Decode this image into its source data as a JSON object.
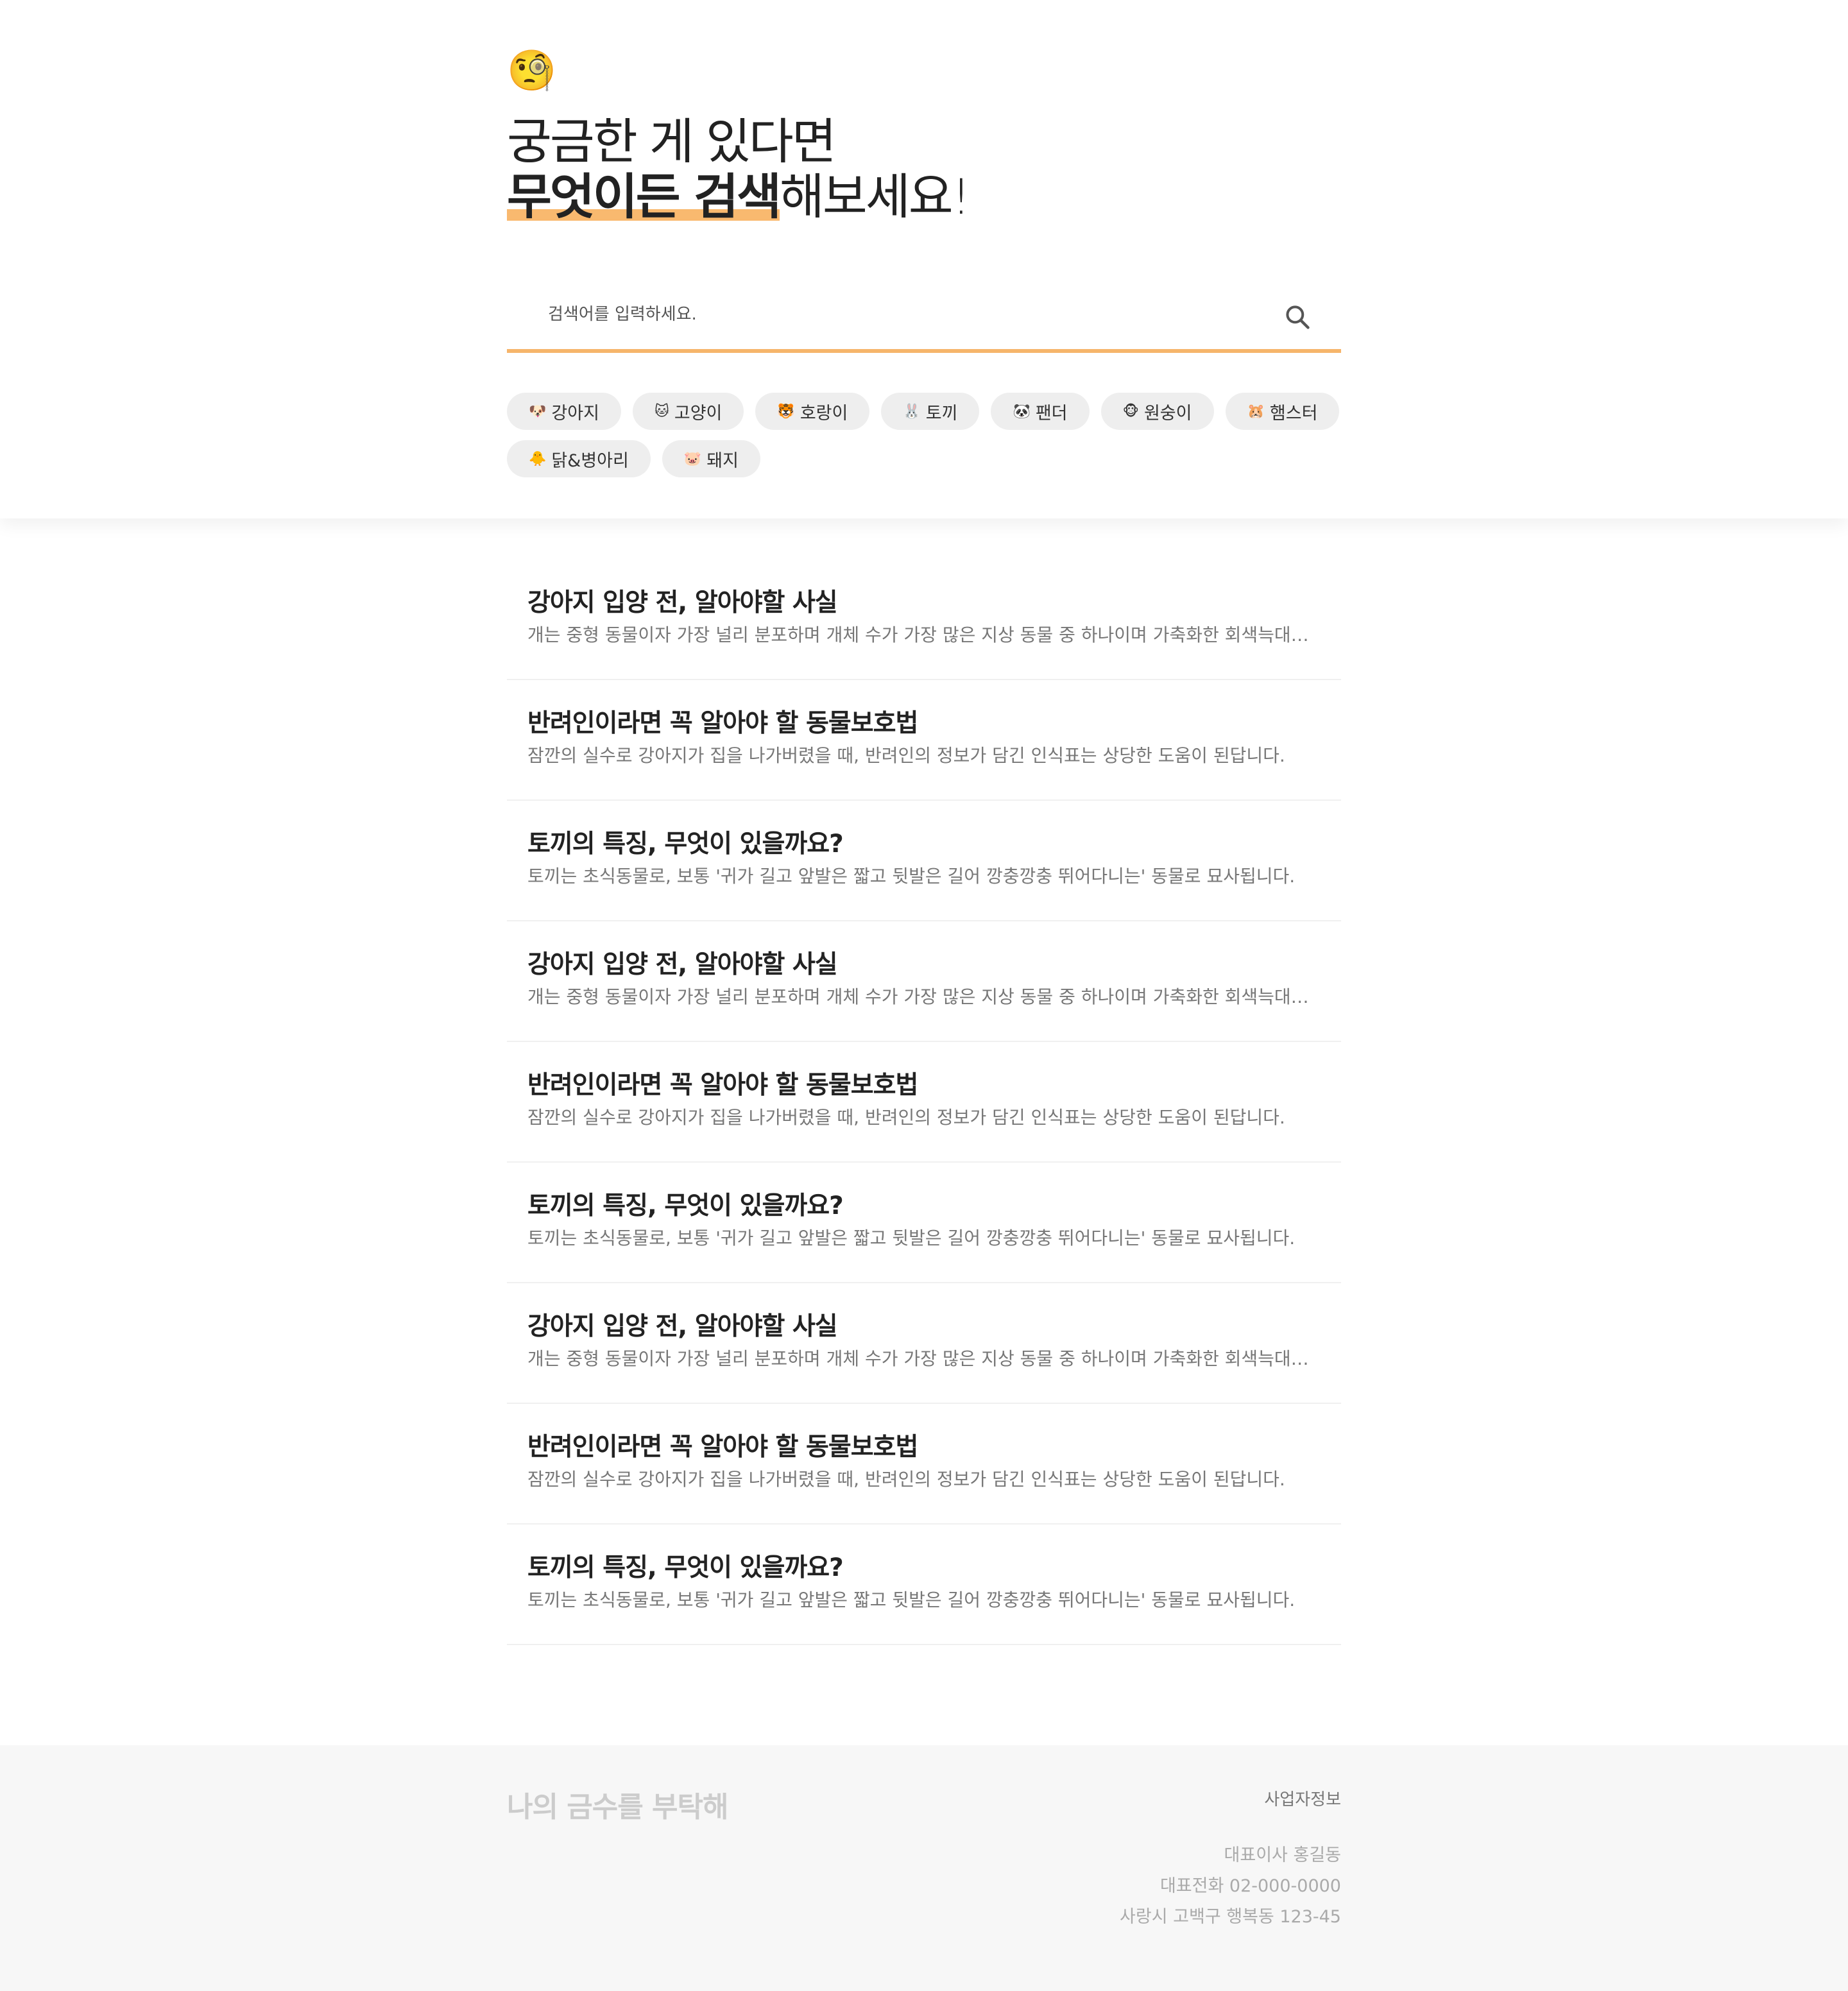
{
  "header": {
    "face_emoji": "🧐",
    "headline_line1": "궁금한 게 있다면",
    "headline_bold": "무엇이든 검색",
    "headline_rest": "해보세요!"
  },
  "search": {
    "placeholder": "검색어를 입력하세요.",
    "icon": "search-icon",
    "accent_color": "#f6b56b"
  },
  "chips": [
    {
      "emoji": "🐶",
      "label": "강아지"
    },
    {
      "emoji": "🐱",
      "label": "고양이"
    },
    {
      "emoji": "🐯",
      "label": "호랑이"
    },
    {
      "emoji": "🐰",
      "label": "토끼"
    },
    {
      "emoji": "🐼",
      "label": "팬더"
    },
    {
      "emoji": "🐵",
      "label": "원숭이"
    },
    {
      "emoji": "🐹",
      "label": "햄스터"
    },
    {
      "emoji": "🐥",
      "label": "닭&병아리"
    },
    {
      "emoji": "🐷",
      "label": "돼지"
    }
  ],
  "articles": [
    {
      "title": "강아지 입양 전, 알아야할 사실",
      "desc": "개는 중형 동물이자 가장 널리 분포하며 개체 수가 가장 많은 지상 동물 중 하나이며 가축화한 회색늑대입니다."
    },
    {
      "title": "반려인이라면 꼭 알아야 할 동물보호법",
      "desc": "잠깐의 실수로 강아지가 집을 나가버렸을 때, 반려인의 정보가 담긴 인식표는 상당한 도움이 된답니다."
    },
    {
      "title": "토끼의 특징, 무엇이 있을까요?",
      "desc": "토끼는 초식동물로, 보통 '귀가 길고 앞발은 짧고 뒷발은 길어 깡충깡충 뛰어다니는' 동물로 묘사됩니다."
    },
    {
      "title": "강아지 입양 전, 알아야할 사실",
      "desc": "개는 중형 동물이자 가장 널리 분포하며 개체 수가 가장 많은 지상 동물 중 하나이며 가축화한 회색늑대입니다."
    },
    {
      "title": "반려인이라면 꼭 알아야 할 동물보호법",
      "desc": "잠깐의 실수로 강아지가 집을 나가버렸을 때, 반려인의 정보가 담긴 인식표는 상당한 도움이 된답니다."
    },
    {
      "title": "토끼의 특징, 무엇이 있을까요?",
      "desc": "토끼는 초식동물로, 보통 '귀가 길고 앞발은 짧고 뒷발은 길어 깡충깡충 뛰어다니는' 동물로 묘사됩니다."
    },
    {
      "title": "강아지 입양 전, 알아야할 사실",
      "desc": "개는 중형 동물이자 가장 널리 분포하며 개체 수가 가장 많은 지상 동물 중 하나이며 가축화한 회색늑대입니다."
    },
    {
      "title": "반려인이라면 꼭 알아야 할 동물보호법",
      "desc": "잠깐의 실수로 강아지가 집을 나가버렸을 때, 반려인의 정보가 담긴 인식표는 상당한 도움이 된답니다."
    },
    {
      "title": "토끼의 특징, 무엇이 있을까요?",
      "desc": "토끼는 초식동물로, 보통 '귀가 길고 앞발은 짧고 뒷발은 길어 깡충깡충 뛰어다니는' 동물로 묘사됩니다."
    }
  ],
  "footer": {
    "logo": "나의 금수를 부탁해",
    "biz_link": "사업자정보",
    "ceo": "대표이사 홍길동",
    "phone": "대표전화 02-000-0000",
    "address": "사랑시 고백구 행복동 123-45"
  }
}
